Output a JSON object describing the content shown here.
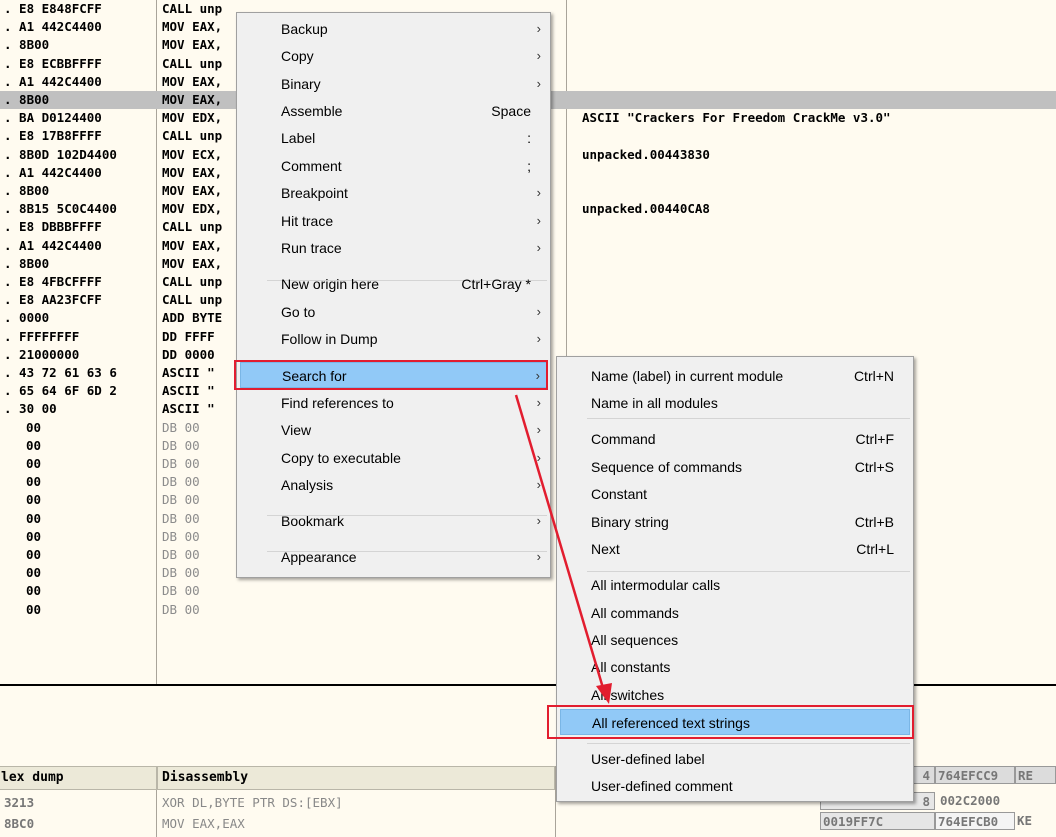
{
  "disasm_rows": [
    {
      "hex": ". E8 E848FCFF",
      "dis": "CALL unp",
      "cmt": ""
    },
    {
      "hex": ". A1 442C4400",
      "dis": "MOV EAX,",
      "cmt": ""
    },
    {
      "hex": ". 8B00",
      "dis": "MOV EAX,",
      "cmt": ""
    },
    {
      "hex": ". E8 ECBBFFFF",
      "dis": "CALL unp",
      "cmt": ""
    },
    {
      "hex": ". A1 442C4400",
      "dis": "MOV EAX,",
      "cmt": ""
    },
    {
      "hex": ". 8B00",
      "dis": "MOV EAX,",
      "cmt": "",
      "selected": true
    },
    {
      "hex": ". BA D0124400",
      "dis": "MOV EDX,",
      "cmt": "ASCII \"Crackers For Freedom CrackMe v3.0\""
    },
    {
      "hex": ". E8 17B8FFFF",
      "dis": "CALL unp",
      "cmt": ""
    },
    {
      "hex": ". 8B0D 102D4400",
      "dis": "MOV ECX,",
      "cmt": "unpacked.00443830"
    },
    {
      "hex": ". A1 442C4400",
      "dis": "MOV EAX,",
      "cmt": ""
    },
    {
      "hex": ". 8B00",
      "dis": "MOV EAX,",
      "cmt": ""
    },
    {
      "hex": ". 8B15 5C0C4400",
      "dis": "MOV EDX,",
      "cmt": "unpacked.00440CA8"
    },
    {
      "hex": ". E8 DBBBFFFF",
      "dis": "CALL unp",
      "cmt": ""
    },
    {
      "hex": ". A1 442C4400",
      "dis": "MOV EAX,",
      "cmt": ""
    },
    {
      "hex": ". 8B00",
      "dis": "MOV EAX,",
      "cmt": ""
    },
    {
      "hex": ". E8 4FBCFFFF",
      "dis": "CALL unp",
      "cmt": ""
    },
    {
      "hex": ". E8 AA23FCFF",
      "dis": "CALL unp",
      "cmt": ""
    },
    {
      "hex": ". 0000",
      "dis": "ADD BYTE",
      "cmt": ""
    },
    {
      "hex": ". FFFFFFFF",
      "dis": "DD FFFF",
      "cmt": ""
    },
    {
      "hex": ". 21000000",
      "dis": "DD 0000",
      "cmt": ""
    },
    {
      "hex": ". 43 72 61 63 6",
      "dis": "ASCII \"",
      "cmt": ""
    },
    {
      "hex": ". 65 64 6F 6D 2",
      "dis": "ASCII \"",
      "cmt": ""
    },
    {
      "hex": ". 30 00",
      "dis": "ASCII \"",
      "cmt": ""
    },
    {
      "hex": "00",
      "dis": "DB 00",
      "cmt": "",
      "dim": true
    },
    {
      "hex": "00",
      "dis": "DB 00",
      "cmt": "",
      "dim": true
    },
    {
      "hex": "00",
      "dis": "DB 00",
      "cmt": "",
      "dim": true
    },
    {
      "hex": "00",
      "dis": "DB 00",
      "cmt": "",
      "dim": true
    },
    {
      "hex": "00",
      "dis": "DB 00",
      "cmt": "",
      "dim": true
    },
    {
      "hex": "00",
      "dis": "DB 00",
      "cmt": "",
      "dim": true
    },
    {
      "hex": "00",
      "dis": "DB 00",
      "cmt": "",
      "dim": true
    },
    {
      "hex": "00",
      "dis": "DB 00",
      "cmt": "",
      "dim": true
    },
    {
      "hex": "00",
      "dis": "DB 00",
      "cmt": "",
      "dim": true
    },
    {
      "hex": "00",
      "dis": "DB 00",
      "cmt": "",
      "dim": true
    },
    {
      "hex": "00",
      "dis": "DB 00",
      "cmt": "",
      "dim": true
    }
  ],
  "dump": {
    "header_hex": "lex dump",
    "header_disasm": "Disassembly",
    "rows": [
      {
        "hex": "3213",
        "dis": "XOR DL,BYTE PTR DS:[EBX]"
      },
      {
        "hex": "8BC0",
        "dis": "MOV EAX,EAX"
      }
    ]
  },
  "stack": {
    "top_left": "4",
    "top_mid": "764EFCC9",
    "top_right": "RE",
    "r2_left": "8",
    "r2_mid": "002C2000",
    "r3_left": "0019FF7C",
    "r3_mid": "764EFCB0",
    "r3_right": "KE"
  },
  "context_menu": {
    "items": [
      {
        "label": "Backup",
        "shortcut": "",
        "submenu": true
      },
      {
        "label": "Copy",
        "shortcut": "",
        "submenu": true
      },
      {
        "label": "Binary",
        "shortcut": "",
        "submenu": true
      },
      {
        "label": "Assemble",
        "shortcut": "Space",
        "submenu": false
      },
      {
        "label": "Label",
        "shortcut": ":",
        "submenu": false
      },
      {
        "label": "Comment",
        "shortcut": ";",
        "submenu": false
      },
      {
        "label": "Breakpoint",
        "shortcut": "",
        "submenu": true
      },
      {
        "label": "Hit trace",
        "shortcut": "",
        "submenu": true
      },
      {
        "label": "Run trace",
        "shortcut": "",
        "submenu": true
      },
      {
        "label": "New origin here",
        "shortcut": "Ctrl+Gray *",
        "submenu": false
      },
      {
        "label": "Go to",
        "shortcut": "",
        "submenu": true
      },
      {
        "label": "Follow in Dump",
        "shortcut": "",
        "submenu": true
      },
      {
        "label": "Search for",
        "shortcut": "",
        "submenu": true,
        "highlighted": true
      },
      {
        "label": "Find references to",
        "shortcut": "",
        "submenu": true
      },
      {
        "label": "View",
        "shortcut": "",
        "submenu": true
      },
      {
        "label": "Copy to executable",
        "shortcut": "",
        "submenu": true
      },
      {
        "label": "Analysis",
        "shortcut": "",
        "submenu": true
      },
      {
        "label": "Bookmark",
        "shortcut": "",
        "submenu": true
      },
      {
        "label": "Appearance",
        "shortcut": "",
        "submenu": true
      }
    ]
  },
  "search_submenu": {
    "items": [
      {
        "label": "Name (label) in current module",
        "shortcut": "Ctrl+N"
      },
      {
        "label": "Name in all modules",
        "shortcut": ""
      },
      {
        "label": "Command",
        "shortcut": "Ctrl+F"
      },
      {
        "label": "Sequence of commands",
        "shortcut": "Ctrl+S"
      },
      {
        "label": "Constant",
        "shortcut": ""
      },
      {
        "label": "Binary string",
        "shortcut": "Ctrl+B"
      },
      {
        "label": "Next",
        "shortcut": "Ctrl+L"
      },
      {
        "label": "All intermodular calls",
        "shortcut": ""
      },
      {
        "label": "All commands",
        "shortcut": ""
      },
      {
        "label": "All sequences",
        "shortcut": ""
      },
      {
        "label": "All constants",
        "shortcut": ""
      },
      {
        "label": "All switches",
        "shortcut": ""
      },
      {
        "label": "All referenced text strings",
        "shortcut": "",
        "highlighted": true
      },
      {
        "label": "User-defined label",
        "shortcut": ""
      },
      {
        "label": "User-defined comment",
        "shortcut": ""
      }
    ]
  },
  "arrow_glyph": "›",
  "colors": {
    "highlight": "#91c9f7",
    "annotation_red": "#e21d2f",
    "selected_row": "#c0c0c0"
  }
}
